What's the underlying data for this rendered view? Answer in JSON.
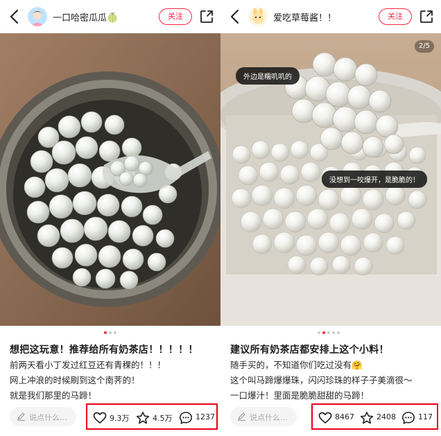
{
  "posts": [
    {
      "author": {
        "name": "一口哈密瓜瓜🍈"
      },
      "follow_label": "关注",
      "title": "想把这玩意！推荐给所有奶茶店！！！！！",
      "body_lines": [
        "前两天看小丁发过红豆还有青稞的！！！",
        "网上冲浪的时候刷到这个南荠的！",
        "就是我们那里的马蹄！"
      ],
      "comment_placeholder": "说点什么...",
      "likes": "9.3万",
      "collects": "4.5万",
      "comments": "1237"
    },
    {
      "author": {
        "name": "爱吃草莓酱！！"
      },
      "follow_label": "关注",
      "page_indicator": "2/5",
      "photo_captions": [
        "外边是糯叽叽的",
        "没想到一咬爆开，是脆脆的！"
      ],
      "title": "建议所有奶茶店都安排上这个小料！",
      "body_lines": [
        "随手买的，不知道你们吃过没有🤗",
        "这个叫马蹄爆爆珠，闪闪珍珠的样子子美滴很～",
        "一口爆汁！里面是脆脆甜甜的马蹄！"
      ],
      "comment_placeholder": "说点什么...",
      "likes": "8467",
      "collects": "2408",
      "comments": "117"
    }
  ],
  "colors": {
    "accent": "#ff2442",
    "highlight_box": "#e8001c"
  },
  "icons": [
    "back-arrow-icon",
    "share-icon",
    "pen-icon",
    "heart-icon",
    "star-icon",
    "comment-icon"
  ]
}
